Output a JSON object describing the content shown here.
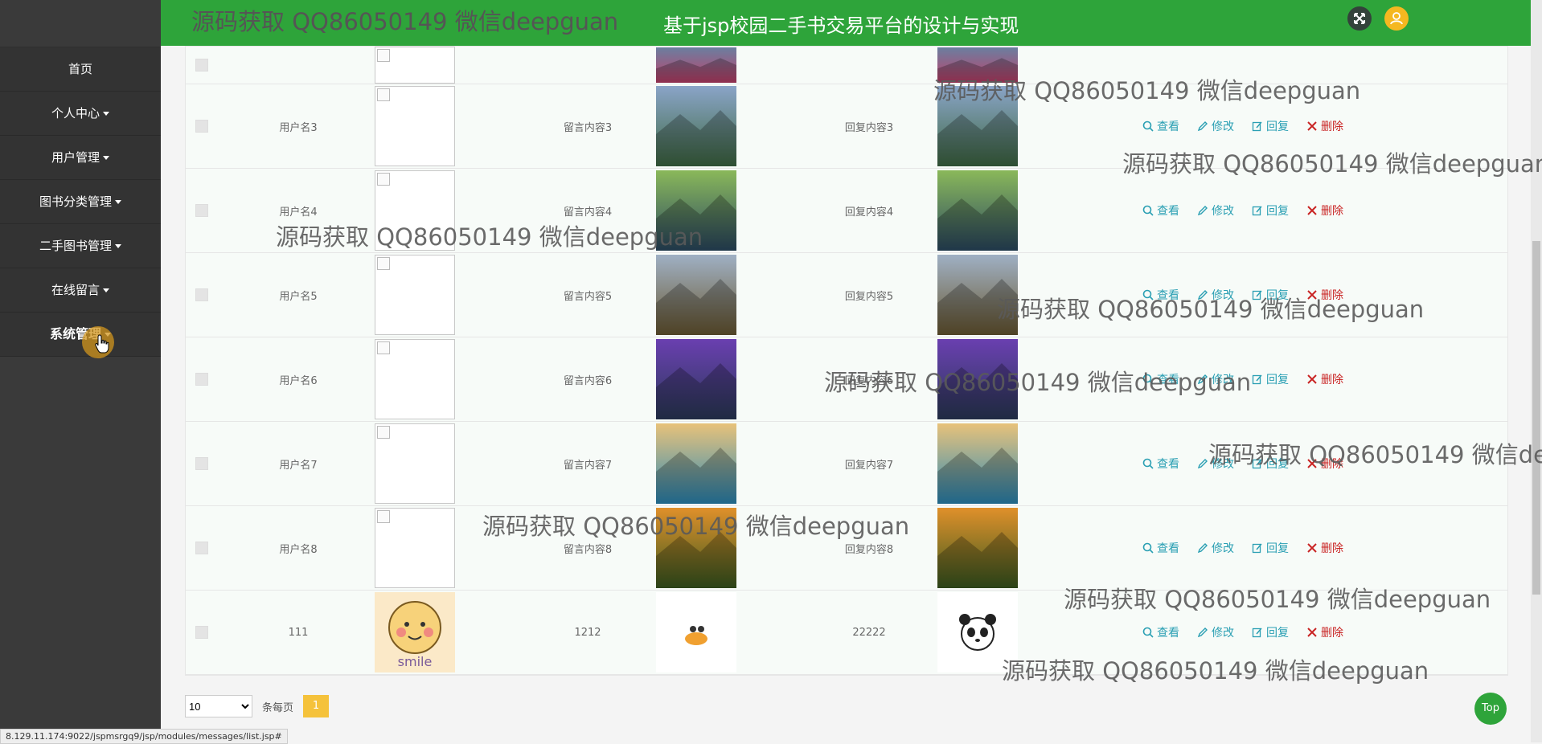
{
  "app": {
    "title": "基于jsp校园二手书交易平台的设计与实现"
  },
  "watermark": "源码获取 QQ86050149 微信deepguan",
  "sidebar": {
    "items": [
      {
        "label": "首页"
      },
      {
        "label": "个人中心"
      },
      {
        "label": "用户管理"
      },
      {
        "label": "图书分类管理"
      },
      {
        "label": "二手图书管理"
      },
      {
        "label": "在线留言"
      },
      {
        "label": "系统管理"
      }
    ]
  },
  "table": {
    "rows": [
      {
        "name": "",
        "message": "",
        "reply": "",
        "scene": "mountain-pink"
      },
      {
        "name": "用户名3",
        "message": "留言内容3",
        "reply": "回复内容3",
        "scene": "cliff-lake"
      },
      {
        "name": "用户名4",
        "message": "留言内容4",
        "reply": "回复内容4",
        "scene": "forest-river"
      },
      {
        "name": "用户名5",
        "message": "留言内容5",
        "reply": "回复内容5",
        "scene": "lake-tree"
      },
      {
        "name": "用户名6",
        "message": "留言内容6",
        "reply": "回复内容6",
        "scene": "purple-shore"
      },
      {
        "name": "用户名7",
        "message": "留言内容7",
        "reply": "回复内容7",
        "scene": "mountain-lake"
      },
      {
        "name": "用户名8",
        "message": "留言内容8",
        "reply": "回复内容8",
        "scene": "autumn-path"
      },
      {
        "name": "111",
        "message": "1212",
        "reply": "22222",
        "scene": "cartoon"
      }
    ],
    "ops": {
      "view": "查看",
      "edit": "修改",
      "reply": "回复",
      "delete": "删除"
    }
  },
  "pagination": {
    "page_size": "10",
    "per_page_label": "条每页",
    "current_page": "1"
  },
  "top_button": "Top",
  "status_bar": "8.129.11.174:9022/jspmsrgq9/jsp/modules/messages/list.jsp#",
  "colors": {
    "topbar": "#2ea43a",
    "sidebar": "#3a3a3a",
    "accent": "#f5c23b",
    "link": "#2a9fb3",
    "delete": "#c92424"
  }
}
